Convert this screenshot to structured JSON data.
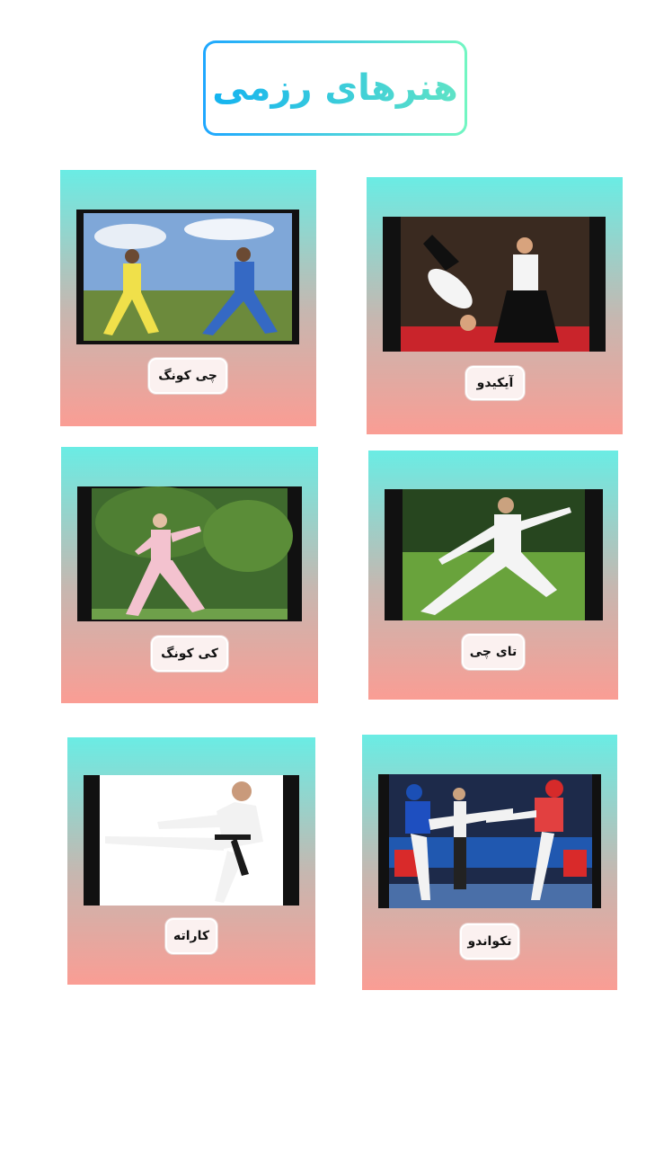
{
  "title": "هنرهای رزمی",
  "cards": [
    {
      "name": "آیکیدو",
      "image": "aikido-photo"
    },
    {
      "name": "چی کونگ",
      "image": "chi-kung-photo"
    },
    {
      "name": "تای چی",
      "image": "tai-chi-photo"
    },
    {
      "name": "کی کونگ",
      "image": "qi-gong-photo"
    },
    {
      "name": "تکواندو",
      "image": "taekwondo-photo"
    },
    {
      "name": "کاراته",
      "image": "karate-photo"
    }
  ],
  "colors": {
    "card_top": "#6aece4",
    "card_bottom": "#fa9d94",
    "title_gradient_start": "#1ea7ff",
    "title_gradient_end": "#72f6c2"
  }
}
